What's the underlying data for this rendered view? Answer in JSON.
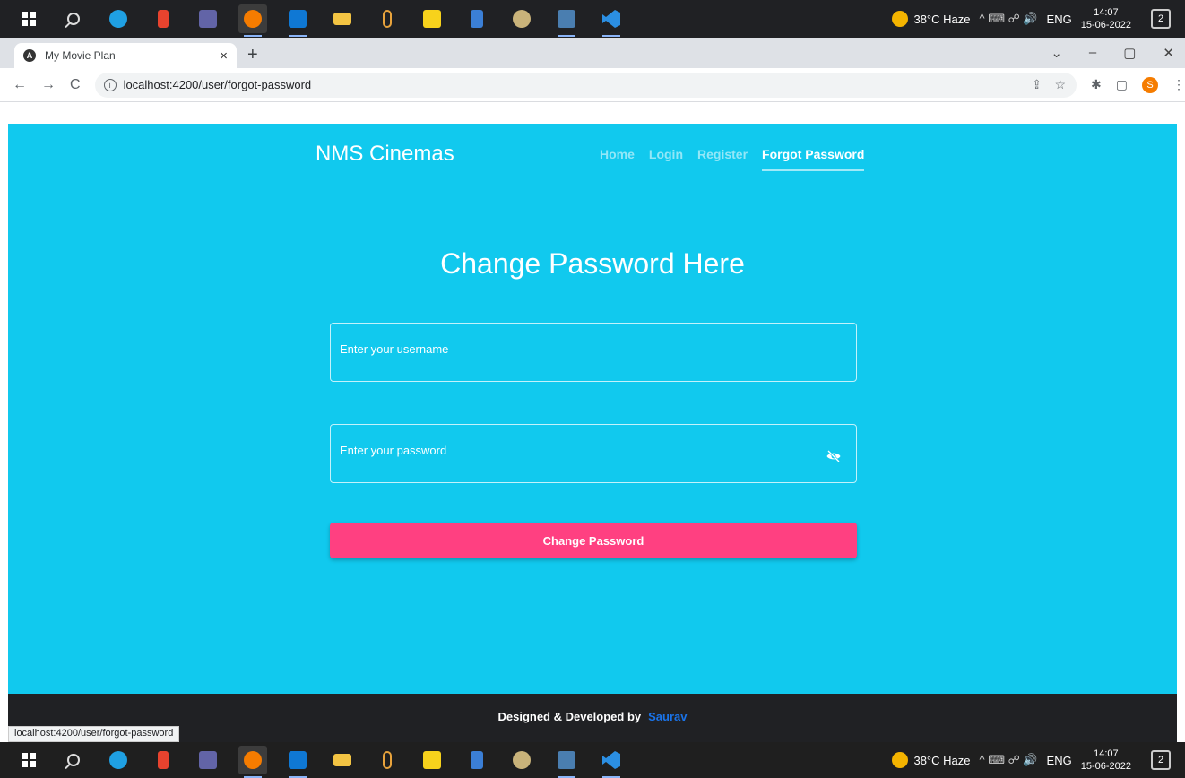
{
  "taskbar": {
    "weather": "38°C Haze",
    "tray_symbols": "^ ⌨ ☍ 🔊",
    "language": "ENG",
    "time": "14:07",
    "date": "15-06-2022",
    "notification_count": "2"
  },
  "browser": {
    "tab_title": "My Movie Plan",
    "tab_close": "×",
    "new_tab": "+",
    "url": "localhost:4200/user/forgot-password",
    "profile_initial": "S",
    "window_controls": [
      "⌄",
      "–",
      "▢",
      "✕"
    ]
  },
  "navbar": {
    "brand": "NMS Cinemas",
    "links": [
      "Home",
      "Login",
      "Register",
      "Forgot Password"
    ],
    "active_link": "Forgot Password"
  },
  "form": {
    "title": "Change Password Here",
    "username_placeholder": "Enter your username",
    "password_placeholder": "Enter your password",
    "submit_label": "Change Password"
  },
  "footer": {
    "text": "Designed & Developed by",
    "author": "Saurav"
  },
  "status_bar_url": "localhost:4200/user/forgot-password",
  "colors": {
    "page_background": "#11c9ee",
    "button": "#ff4081",
    "footer": "#202124",
    "author_link": "#1a73e8"
  }
}
